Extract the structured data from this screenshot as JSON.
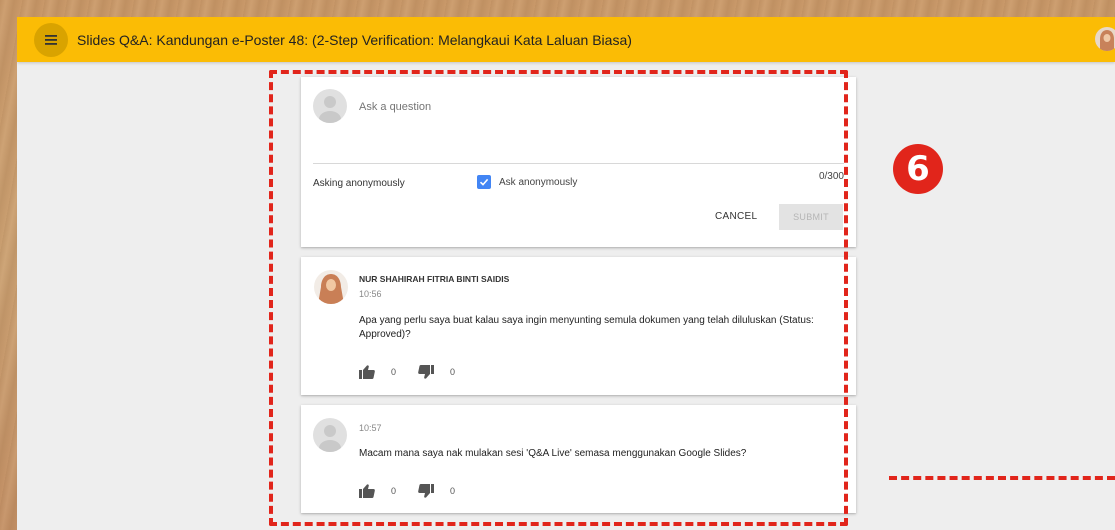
{
  "header": {
    "title": "Slides Q&A: Kandungan e-Poster 48: (2-Step Verification: Melangkaui Kata Laluan Biasa)",
    "menu_icon": "menu-icon",
    "accent_color": "#fbbc05"
  },
  "ask": {
    "placeholder": "Ask a question",
    "asking_label": "Asking anonymously",
    "checkbox_label": "Ask anonymously",
    "checkbox_checked": true,
    "counter": "0/300",
    "cancel_label": "CANCEL",
    "submit_label": "SUBMIT"
  },
  "questions": [
    {
      "author": "NUR SHAHIRAH FITRIA BINTI SAIDIS",
      "time": "10:56",
      "text": "Apa yang perlu saya buat kalau saya ingin menyunting semula dokumen yang telah diluluskan (Status: Approved)?",
      "likes": "0",
      "dislikes": "0"
    },
    {
      "author": "",
      "time": "10:57",
      "text": "Macam mana saya nak mulakan sesi 'Q&A Live' semasa menggunakan Google Slides?",
      "likes": "0",
      "dislikes": "0"
    }
  ],
  "annotation": {
    "number": "6",
    "color": "#e1251b"
  }
}
